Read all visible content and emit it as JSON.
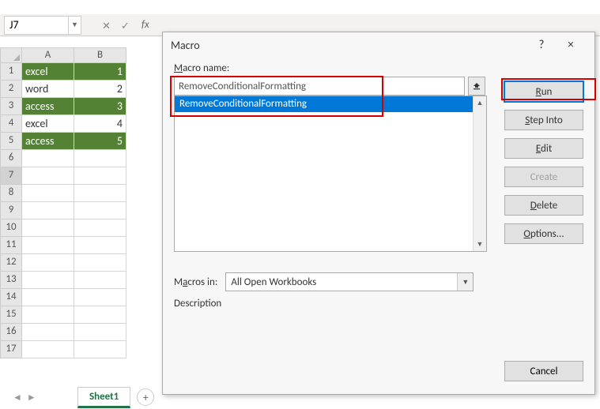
{
  "namebox": {
    "value": "J7"
  },
  "formula_bar": {
    "fx": "fx"
  },
  "columns": [
    "A",
    "B"
  ],
  "rows": [
    {
      "n": 1,
      "a": "excel",
      "b": "1",
      "hi": true
    },
    {
      "n": 2,
      "a": "word",
      "b": "2",
      "hi": false
    },
    {
      "n": 3,
      "a": "access",
      "b": "3",
      "hi": true
    },
    {
      "n": 4,
      "a": "excel",
      "b": "4",
      "hi": false
    },
    {
      "n": 5,
      "a": "access",
      "b": "5",
      "hi": true
    },
    {
      "n": 6,
      "a": "",
      "b": "",
      "hi": false
    },
    {
      "n": 7,
      "a": "",
      "b": "",
      "hi": false
    },
    {
      "n": 8,
      "a": "",
      "b": "",
      "hi": false
    },
    {
      "n": 9,
      "a": "",
      "b": "",
      "hi": false
    },
    {
      "n": 10,
      "a": "",
      "b": "",
      "hi": false
    },
    {
      "n": 11,
      "a": "",
      "b": "",
      "hi": false
    },
    {
      "n": 12,
      "a": "",
      "b": "",
      "hi": false
    },
    {
      "n": 13,
      "a": "",
      "b": "",
      "hi": false
    },
    {
      "n": 14,
      "a": "",
      "b": "",
      "hi": false
    },
    {
      "n": 15,
      "a": "",
      "b": "",
      "hi": false
    },
    {
      "n": 16,
      "a": "",
      "b": "",
      "hi": false
    },
    {
      "n": 17,
      "a": "",
      "b": "",
      "hi": false
    }
  ],
  "tabs": {
    "active": "Sheet1"
  },
  "dialog": {
    "title": "Macro",
    "help": "?",
    "close": "×",
    "name_label": "Macro name:",
    "name_value": "RemoveConditionalFormatting",
    "list": [
      "RemoveConditionalFormatting"
    ],
    "macros_in_label": "Macros in:",
    "macros_in_value": "All Open Workbooks",
    "description_label": "Description",
    "buttons": {
      "run": "Run",
      "step_into": "Step Into",
      "edit": "Edit",
      "create": "Create",
      "delete": "Delete",
      "options": "Options...",
      "cancel": "Cancel"
    }
  }
}
